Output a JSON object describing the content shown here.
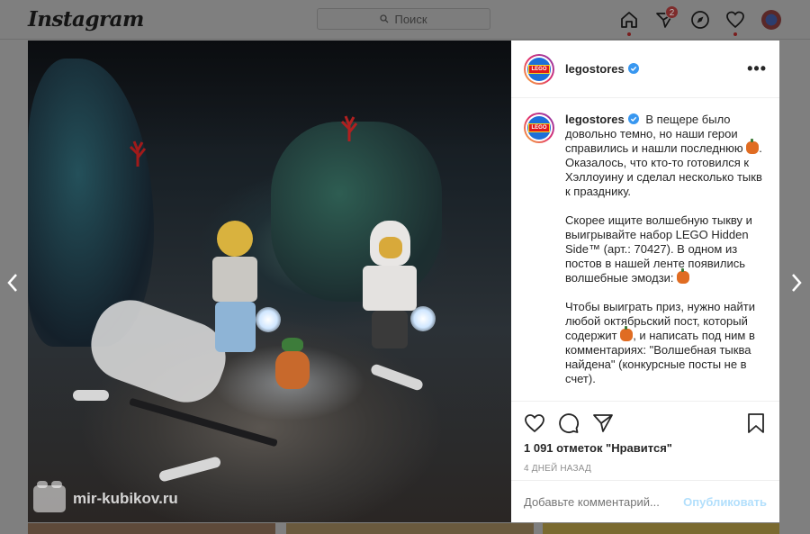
{
  "colors": {
    "overlay": "#7f7f7f",
    "accent": "#0095f6",
    "publish_disabled": "#b2dffc",
    "muted": "#8e8e8e"
  },
  "nav": {
    "logo": "Instagram",
    "search_placeholder": "Поиск",
    "icons": [
      "home-icon",
      "direct-icon",
      "explore-icon",
      "activity-icon",
      "profile-avatar"
    ],
    "direct_badge": "2"
  },
  "post": {
    "username": "legostores",
    "avatar_text": "LEGO",
    "more_label": "•••",
    "caption": {
      "p1": "В пещере было довольно темно, но наши герои справились и нашли последнюю",
      "p1_tail": ". Оказалось, что кто-то готовился к Хэллоуину и сделал несколько тыкв к празднику.",
      "p2": "Скорее ищите волшебную тыкву и выигрывайте набор LEGO Hidden Side™ (арт.: 70427). В одном из постов в нашей ленте появились волшебные эмодзи:",
      "p3": "Чтобы выиграть приз, нужно найти любой октябрьский пост, который содержит",
      "p3_tail": ", и написать под ним в комментариях: \"Волшебная тыква найдена\" (конкурсные посты не в счет)."
    },
    "likes": "1 091 отметок \"Нравится\"",
    "date": "4 ДНЕЙ НАЗАД",
    "comment_placeholder": "Добавьте комментарий...",
    "publish_label": "Опубликовать",
    "actions": [
      "like-icon",
      "comment-icon",
      "share-icon",
      "save-icon"
    ]
  },
  "watermark": "mir-kubikov.ru"
}
